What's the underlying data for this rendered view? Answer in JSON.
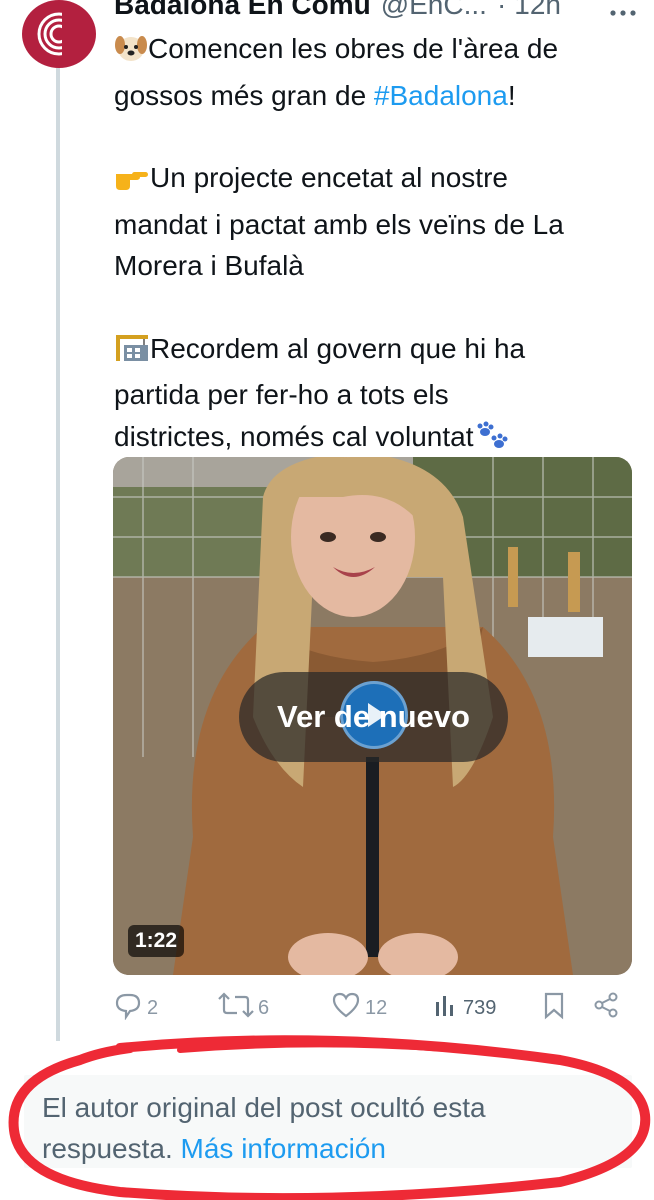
{
  "tweet": {
    "author_name": "Badalona En Comú",
    "handle": "@EnC...",
    "separator": "·",
    "time_ago": "12h",
    "text_lines": [
      "Comencen les obres de l'àrea de",
      "gossos més gran de ",
      "#Badalona",
      "!",
      "Un projecte encetat al nostre",
      "mandat i pactat amb els veïns de La",
      "Morera i Bufalà",
      "Recordem al govern que hi ha",
      "partida per fer-ho a tots els",
      "districtes, només cal voluntat"
    ]
  },
  "video": {
    "replay_label": "Ver de nuevo",
    "duration": "1:22"
  },
  "actions": {
    "replies": "2",
    "reposts": "6",
    "likes": "12",
    "views": "739"
  },
  "notice": {
    "text": "El autor original del post ocultó esta respuesta.",
    "link": "Más información"
  },
  "icons": {
    "more": "more-horizontal-icon",
    "reply": "reply-icon",
    "repost": "repost-icon",
    "like": "heart-icon",
    "views": "views-icon",
    "bookmark": "bookmark-icon",
    "share": "share-icon"
  },
  "colors": {
    "link": "#1d9bf0",
    "avatar": "#b3203f",
    "annotation": "#ee2a36"
  }
}
